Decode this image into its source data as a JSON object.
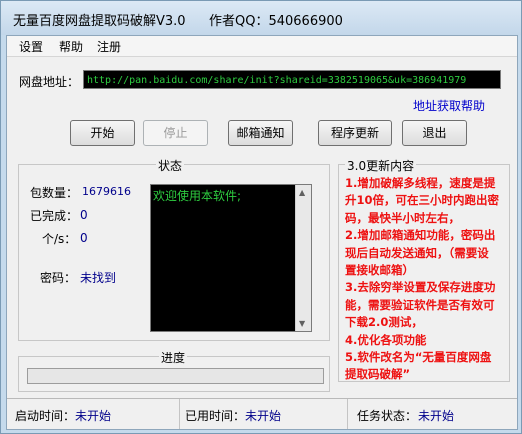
{
  "window": {
    "title": "无量百度网盘提取码破解V3.0",
    "author": "作者QQ：540666900"
  },
  "menu": [
    "设置",
    "帮助",
    "注册"
  ],
  "url": {
    "label": "网盘地址：",
    "value": "http://pan.baidu.com/share/init?shareid=3382519065&uk=386941979"
  },
  "help_link": "地址获取帮助",
  "buttons": {
    "start": "开始",
    "stop": "停止",
    "email": "邮箱通知",
    "update": "程序更新",
    "exit": "退出"
  },
  "status": {
    "title": "状态",
    "packets_label": "包数量：",
    "packets_value": "1679616",
    "done_label": "已完成：",
    "done_value": "0",
    "rate_label": "个/s：",
    "rate_value": "0",
    "password_label": "密码：",
    "password_value": "未找到",
    "console": "欢迎使用本软件;"
  },
  "updates": {
    "title": "3.0更新内容",
    "lines": [
      "1.增加破解多线程，速度是提",
      "升10倍，可在三小时内跑出密",
      "码，最快半小时左右，",
      "2.增加邮箱通知功能，密码出",
      "现后自动发送通知，（需要设",
      "置接收邮箱）",
      "3.去除穷举设置及保存进度功",
      "能，需要验证软件是否有效可",
      "下载2.0测试，",
      "4.优化各项功能",
      "5.软件改名为“无量百度网盘",
      "提取码破解”"
    ]
  },
  "progress": {
    "title": "进度",
    "fraction": 0
  },
  "statusbar": {
    "start_label": "启动时间：",
    "start_value": "未开始",
    "elapsed_label": "已用时间：",
    "elapsed_value": "未开始",
    "task_label": "任务状态：",
    "task_value": "未开始"
  }
}
